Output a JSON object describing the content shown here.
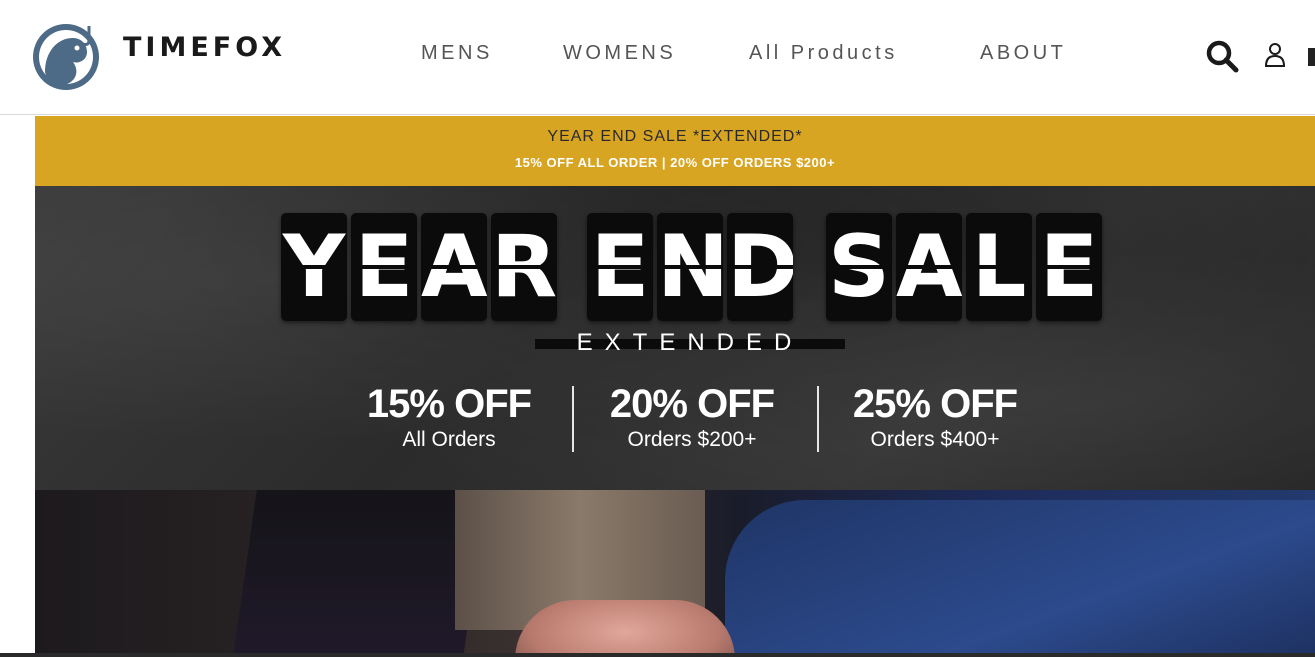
{
  "brand": {
    "name": "TIMEFOX"
  },
  "nav": {
    "items": [
      "MENS",
      "WOMENS",
      "All Products",
      "ABOUT"
    ]
  },
  "header_icons": [
    "search-icon",
    "account-icon"
  ],
  "promo_bar": {
    "line1": "YEAR END SALE *EXTENDED*",
    "line2": "15% OFF ALL ORDER | 20% OFF ORDERS $200+",
    "background": "#d8a523"
  },
  "hero": {
    "flap_words": [
      [
        "Y",
        "E",
        "A",
        "R"
      ],
      [
        "E",
        "N",
        "D"
      ],
      [
        "S",
        "A",
        "L",
        "E"
      ]
    ],
    "subtitle": "EXTENDED",
    "offers": [
      {
        "discount": "15% OFF",
        "condition": "All Orders"
      },
      {
        "discount": "20% OFF",
        "condition": "Orders $200+"
      },
      {
        "discount": "25% OFF",
        "condition": "Orders $400+"
      }
    ]
  }
}
